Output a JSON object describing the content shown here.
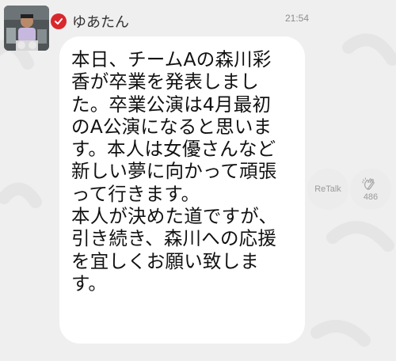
{
  "post": {
    "user_name": "ゆあたん",
    "timestamp": "21:54",
    "message": "本日、チームAの森川彩\n香が卒業を発表しまし\nた。卒業公演は4月最初\nのA公演になると思いま\nす。本人は女優さんなど\n新しい夢に向かって頑張\nって行きます。\n本人が決めた道ですが、\n引き続き、森川への応援\nを宜しくお願い致しま\nす。"
  },
  "actions": {
    "retalk_label": "ReTalk",
    "clap_count": "486"
  },
  "icons": {
    "avatar": "user-avatar-photo",
    "verified": "verified-check-icon",
    "clap": "clapping-hands-icon"
  },
  "colors": {
    "background": "#efefef",
    "bubble": "#ffffff",
    "verified_badge": "#d9272e",
    "secondary_text": "#9a9a9a"
  }
}
